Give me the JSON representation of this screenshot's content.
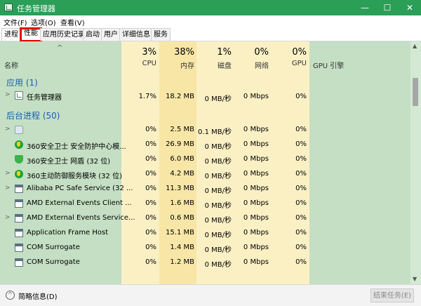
{
  "window": {
    "title": "任务管理器",
    "minimize_glyph": "—",
    "maximize_glyph": "☐",
    "close_glyph": "✕"
  },
  "menu": [
    "文件(F)",
    "选项(O)",
    "查看(V)"
  ],
  "tabs": [
    "进程",
    "性能",
    "应用历史记录",
    "启动",
    "用户",
    "详细信息",
    "服务"
  ],
  "header": {
    "sort_arrow": "^",
    "name_label": "名称",
    "cpu": {
      "pct": "3%",
      "label": "CPU"
    },
    "mem": {
      "pct": "38%",
      "label": "内存"
    },
    "disk": {
      "pct": "1%",
      "label": "磁盘"
    },
    "net": {
      "pct": "0%",
      "label": "网络"
    },
    "gpu": {
      "pct": "0%",
      "label": "GPU"
    },
    "gpu_engine": "GPU 引擎"
  },
  "groups": {
    "apps": "应用 (1)",
    "background": "后台进程 (50)"
  },
  "apps": [
    {
      "name": "任务管理器",
      "cpu": "1.7%",
      "mem": "18.2 MB",
      "disk": "0 MB/秒",
      "net": "0 Mbps",
      "gpu": "0%"
    }
  ],
  "background": [
    {
      "name": "",
      "cpu": "0%",
      "mem": "2.5 MB",
      "disk": "0.1 MB/秒",
      "net": "0 Mbps",
      "gpu": "0%"
    },
    {
      "name": "360安全卫士 安全防护中心模...",
      "cpu": "0%",
      "mem": "26.9 MB",
      "disk": "0 MB/秒",
      "net": "0 Mbps",
      "gpu": "0%"
    },
    {
      "name": "360安全卫士 网盾 (32 位)",
      "cpu": "0%",
      "mem": "6.0 MB",
      "disk": "0 MB/秒",
      "net": "0 Mbps",
      "gpu": "0%"
    },
    {
      "name": "360主动防御服务模块 (32 位)",
      "cpu": "0%",
      "mem": "4.2 MB",
      "disk": "0 MB/秒",
      "net": "0 Mbps",
      "gpu": "0%"
    },
    {
      "name": "Alibaba PC Safe Service (32 ...",
      "cpu": "0%",
      "mem": "11.3 MB",
      "disk": "0 MB/秒",
      "net": "0 Mbps",
      "gpu": "0%"
    },
    {
      "name": "AMD External Events Client ...",
      "cpu": "0%",
      "mem": "1.6 MB",
      "disk": "0 MB/秒",
      "net": "0 Mbps",
      "gpu": "0%"
    },
    {
      "name": "AMD External Events Service...",
      "cpu": "0%",
      "mem": "0.6 MB",
      "disk": "0 MB/秒",
      "net": "0 Mbps",
      "gpu": "0%"
    },
    {
      "name": "Application Frame Host",
      "cpu": "0%",
      "mem": "15.1 MB",
      "disk": "0 MB/秒",
      "net": "0 Mbps",
      "gpu": "0%"
    },
    {
      "name": "COM Surrogate",
      "cpu": "0%",
      "mem": "1.4 MB",
      "disk": "0 MB/秒",
      "net": "0 Mbps",
      "gpu": "0%"
    },
    {
      "name": "COM Surrogate",
      "cpu": "0%",
      "mem": "1.2 MB",
      "disk": "0 MB/秒",
      "net": "0 Mbps",
      "gpu": "0%"
    }
  ],
  "status": {
    "collapse_glyph": "^",
    "summary_label": "简略信息(D)",
    "end_task_label": "结束任务(E)"
  },
  "colors": {
    "titlebar": "#2b9e58",
    "body": "#c4dfc4",
    "heat_light": "#fbf0c4",
    "heat_dark": "#f8e6a6",
    "group": "#1a5fb4",
    "tab_highlight": "#e10000"
  }
}
